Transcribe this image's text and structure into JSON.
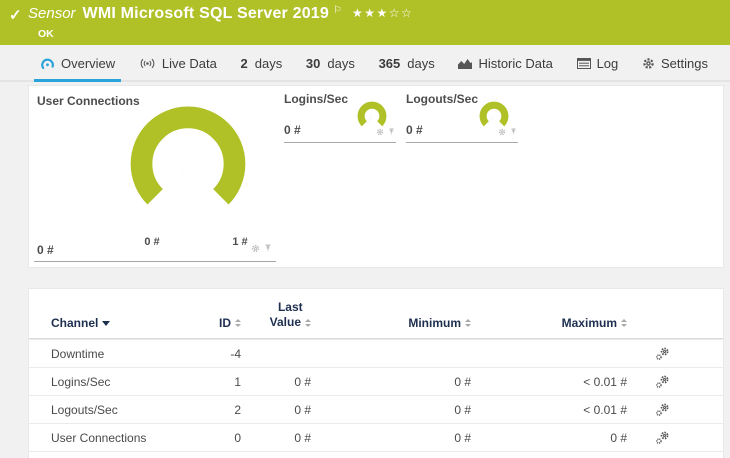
{
  "header": {
    "check": "✓",
    "kind": "Sensor",
    "title": "WMI Microsoft SQL Server 2019",
    "flag": "⚐",
    "stars": "★★★☆☆",
    "status": "OK"
  },
  "tabs": [
    {
      "label": "Overview"
    },
    {
      "label": "Live Data"
    },
    {
      "num": "2",
      "unit": "days"
    },
    {
      "num": "30",
      "unit": "days"
    },
    {
      "num": "365",
      "unit": "days"
    },
    {
      "label": "Historic Data"
    },
    {
      "label": "Log"
    },
    {
      "label": "Settings"
    }
  ],
  "gauges": {
    "user_connections": {
      "title": "User Connections",
      "value": "0 #",
      "scale_min": "0 #",
      "scale_max": "1 #"
    },
    "logins": {
      "title": "Logins/Sec",
      "value": "0 #"
    },
    "logouts": {
      "title": "Logouts/Sec",
      "value": "0 #"
    }
  },
  "table": {
    "header": {
      "channel": "Channel",
      "id": "ID",
      "last_line1": "Last",
      "last_line2": "Value",
      "min": "Minimum",
      "max": "Maximum"
    },
    "rows": [
      {
        "channel": "Downtime",
        "id": "-4",
        "last": "",
        "min": "",
        "max": ""
      },
      {
        "channel": "Logins/Sec",
        "id": "1",
        "last": "0 #",
        "min": "0 #",
        "max": "< 0.01 #"
      },
      {
        "channel": "Logouts/Sec",
        "id": "2",
        "last": "0 #",
        "min": "0 #",
        "max": "< 0.01 #"
      },
      {
        "channel": "User Connections",
        "id": "0",
        "last": "0 #",
        "min": "0 #",
        "max": "0 #"
      }
    ]
  },
  "colors": {
    "green": "#b0c128",
    "blue": "#2aa3da",
    "navy": "#1e2f50"
  }
}
